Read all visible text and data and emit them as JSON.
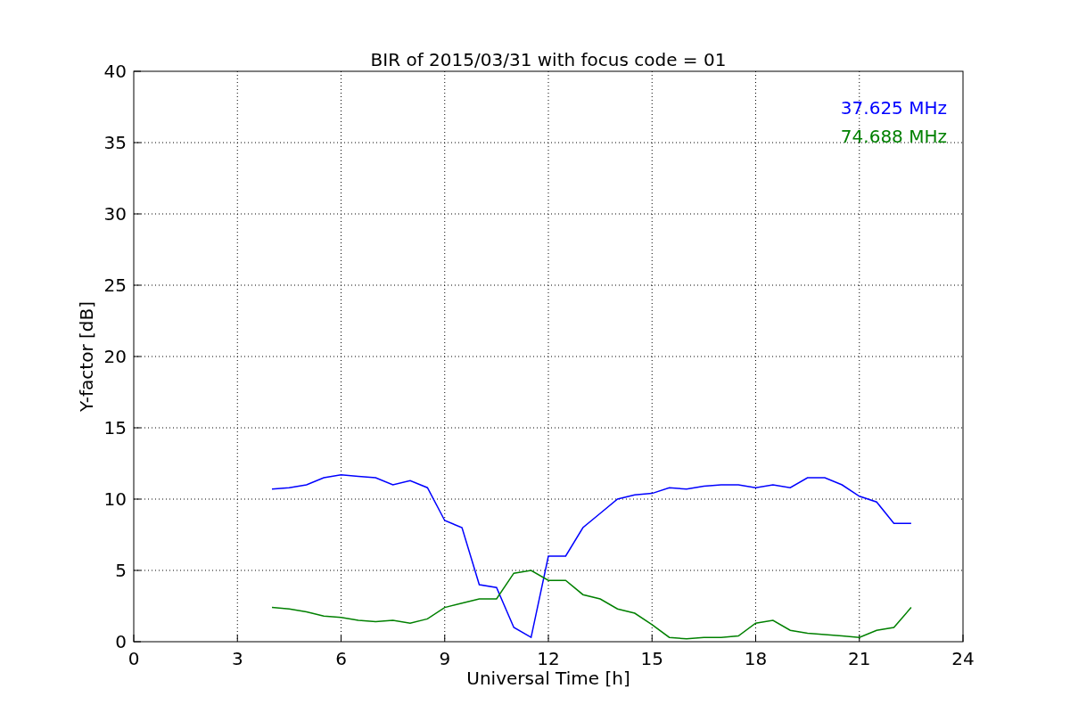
{
  "chart_data": {
    "type": "line",
    "title": "BIR of 2015/03/31 with focus code = 01",
    "xlabel": "Universal Time [h]",
    "ylabel": "Y-factor [dB]",
    "x": [
      4,
      4.5,
      5,
      5.5,
      6,
      6.5,
      7,
      7.5,
      8,
      8.5,
      9,
      9.5,
      10,
      10.5,
      11,
      11.5,
      12,
      12.5,
      13,
      13.5,
      14,
      14.5,
      15,
      15.5,
      16,
      16.5,
      17,
      17.5,
      18,
      18.5,
      19,
      19.5,
      20,
      20.5,
      21,
      21.5,
      22,
      22.5
    ],
    "series": [
      {
        "name": "37.625 MHz",
        "color": "#0000ff",
        "values": [
          10.7,
          10.8,
          11,
          11.5,
          11.7,
          11.6,
          11.5,
          11,
          11.3,
          10.8,
          8.5,
          8,
          4,
          3.8,
          1,
          0.3,
          6,
          6,
          8,
          9,
          10,
          10.3,
          10.4,
          10.8,
          10.7,
          10.9,
          11,
          11,
          10.8,
          11,
          10.8,
          11.5,
          11.5,
          11,
          10.2,
          9.8,
          8.3,
          8.3
        ]
      },
      {
        "name": "74.688 MHz",
        "color": "#008000",
        "values": [
          2.4,
          2.3,
          2.1,
          1.8,
          1.7,
          1.5,
          1.4,
          1.5,
          1.3,
          1.6,
          2.4,
          2.7,
          3,
          3,
          4.8,
          5,
          4.3,
          4.3,
          3.3,
          3,
          2.3,
          2,
          1.2,
          0.3,
          0.2,
          0.3,
          0.3,
          0.4,
          1.3,
          1.5,
          0.8,
          0.6,
          0.5,
          0.4,
          0.3,
          0.8,
          1,
          2.4
        ]
      }
    ],
    "xlim": [
      0,
      24
    ],
    "ylim": [
      0,
      40
    ],
    "xticks": [
      0,
      3,
      6,
      9,
      12,
      15,
      18,
      21,
      24
    ],
    "yticks": [
      0,
      5,
      10,
      15,
      20,
      25,
      30,
      35,
      40
    ],
    "grid": true
  }
}
